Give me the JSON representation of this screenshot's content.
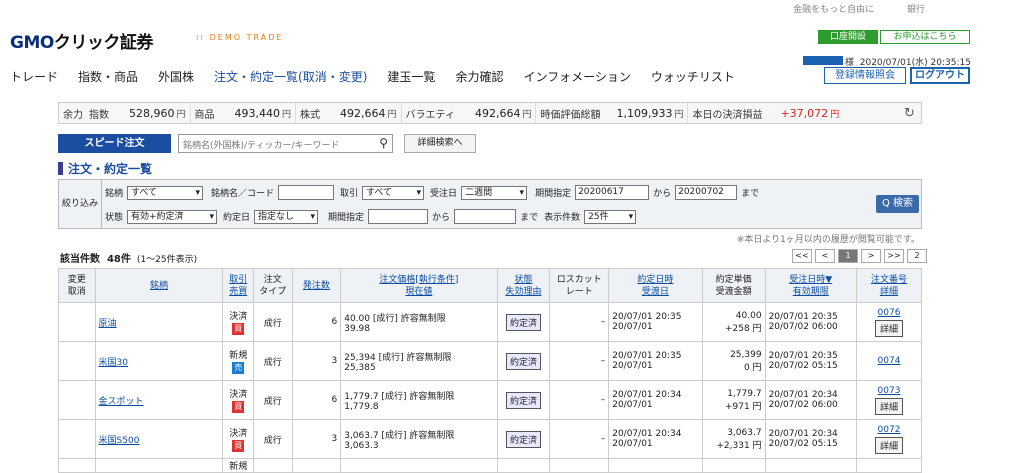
{
  "top_links": [
    "金融をもっと自由に",
    "銀行"
  ],
  "logo": {
    "brand": "GMO",
    "name": "クリック証券"
  },
  "demo_label": "DEMO TRADE",
  "account_buttons": {
    "open": "口座開設",
    "apply": "お申込はこちら"
  },
  "user": {
    "suffix": "様",
    "datetime": "2020/07/01(水) 20:35:15"
  },
  "header_buttons": {
    "info": "登録情報照会",
    "logout": "ログアウト"
  },
  "nav": [
    "トレード",
    "指数・商品",
    "外国株",
    "注文・約定一覧(取消・変更)",
    "建玉一覧",
    "余力確認",
    "インフォメーション",
    "ウォッチリスト"
  ],
  "summary": {
    "yoryoku_label": "余力",
    "items": [
      {
        "label": "指数",
        "value": "528,960",
        "unit": "円"
      },
      {
        "label": "商品",
        "value": "493,440",
        "unit": "円"
      },
      {
        "label": "株式",
        "value": "492,664",
        "unit": "円"
      },
      {
        "label": "バラエティ",
        "value": "492,664",
        "unit": "円"
      },
      {
        "label": "時価評価総額",
        "value": "1,109,933",
        "unit": "円"
      },
      {
        "label": "本日の決済損益",
        "value": "+37,072",
        "unit": "円"
      }
    ]
  },
  "speed_order": "スピード注文",
  "search": {
    "placeholder": "銘柄名(外国株)/ティッカー/キーワード"
  },
  "advanced_search": "詳細検索へ",
  "page_title": "注文・約定一覧",
  "filter": {
    "side": "絞り込み",
    "meigara_label": "銘柄",
    "meigara_value": "すべて",
    "meigara_code_label": "銘柄名／コード",
    "torihiki_label": "取引",
    "torihiki_value": "すべて",
    "juchubi_label": "受注日",
    "juchubi_value": "二週間",
    "kikan_label": "期間指定",
    "kikan_from": "20200617",
    "kara": "から",
    "kikan_to": "20200702",
    "made": "まで",
    "jotai_label": "状態",
    "jotai_value": "有効+約定済",
    "yakujobi_label": "約定日",
    "yakujobi_value": "指定なし",
    "kikan2_label": "期間指定",
    "kara2": "から",
    "made2": "まで",
    "hyoji_label": "表示件数",
    "hyoji_value": "25件",
    "search_btn": "Q 検索"
  },
  "note": "※本日より1ヶ月以内の履歴が閲覧可能です。",
  "count": {
    "label": "該当件数",
    "value": "48件",
    "range": "(1～25件表示)"
  },
  "pager": [
    "<<",
    "<",
    "1",
    ">",
    ">>",
    "2"
  ],
  "headers": [
    [
      "変更",
      "取消"
    ],
    [
      "銘柄",
      ""
    ],
    [
      "取引",
      "売買"
    ],
    [
      "注文",
      "タイプ"
    ],
    [
      "発注数",
      ""
    ],
    [
      "注文価格[執行条件]",
      "現在値"
    ],
    [
      "状態",
      "失効理由"
    ],
    [
      "ロスカット",
      "レート"
    ],
    [
      "約定日時",
      "受渡日"
    ],
    [
      "約定単価",
      "受渡金額"
    ],
    [
      "受注日時▼",
      "有効期限"
    ],
    [
      "注文番号",
      "詳細"
    ]
  ],
  "rows": [
    {
      "name": "原油",
      "trade": "決済",
      "side": "買",
      "side_type": "buy",
      "otype": "成行",
      "qty": "6",
      "price": "40.00 [成行] 許容無制限",
      "current": "39.98",
      "status": "約定済",
      "losscut": "–",
      "exec_dt": "20/07/01 20:35",
      "settle": "20/07/01",
      "unit_price": "40.00",
      "amount": "+258 円",
      "order_dt": "20/07/01 20:35",
      "expire": "20/07/02 06:00",
      "order_no": "0076",
      "detail": "詳細"
    },
    {
      "name": "米国30",
      "trade": "新規",
      "side": "売",
      "side_type": "sell",
      "otype": "成行",
      "qty": "3",
      "price": "25,394 [成行] 許容無制限",
      "current": "25,385",
      "status": "約定済",
      "losscut": "–",
      "exec_dt": "20/07/01 20:35",
      "settle": "20/07/01",
      "unit_price": "25,399",
      "amount": "0 円",
      "order_dt": "20/07/01 20:35",
      "expire": "20/07/02 05:15",
      "order_no": "0074",
      "detail": ""
    },
    {
      "name": "金スポット",
      "trade": "決済",
      "side": "買",
      "side_type": "buy",
      "otype": "成行",
      "qty": "6",
      "price": "1,779.7 [成行] 許容無制限",
      "current": "1,779.8",
      "status": "約定済",
      "losscut": "–",
      "exec_dt": "20/07/01 20:34",
      "settle": "20/07/01",
      "unit_price": "1,779.7",
      "amount": "+971 円",
      "order_dt": "20/07/01 20:34",
      "expire": "20/07/02 06:00",
      "order_no": "0073",
      "detail": "詳細"
    },
    {
      "name": "米国S500",
      "trade": "決済",
      "side": "買",
      "side_type": "buy",
      "otype": "成行",
      "qty": "3",
      "price": "3,063.7 [成行] 許容無制限",
      "current": "3,063.3",
      "status": "約定済",
      "losscut": "–",
      "exec_dt": "20/07/01 20:34",
      "settle": "20/07/01",
      "unit_price": "3,063.7",
      "amount": "+2,331 円",
      "order_dt": "20/07/01 20:34",
      "expire": "20/07/02 05:15",
      "order_no": "0072",
      "detail": "詳細"
    }
  ],
  "partial_row_trade": "新規"
}
